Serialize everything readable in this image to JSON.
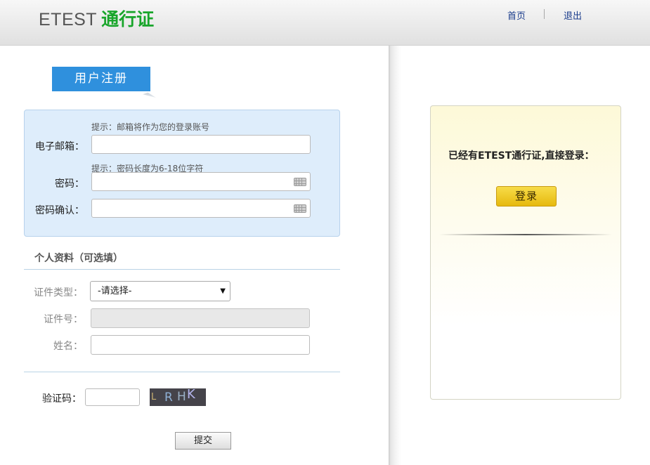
{
  "header": {
    "logo_en": "ETEST",
    "logo_cn": "通行证",
    "nav_home": "首页",
    "nav_logout": "退出"
  },
  "register": {
    "title": "用户注册",
    "email_hint": "提示：邮箱将作为您的登录账号",
    "email_label": "电子邮箱：",
    "password_hint": "提示：密码长度为6-18位字符",
    "password_label": "密码：",
    "confirm_label": "密码确认："
  },
  "profile": {
    "section_title": "个人资料（可选填）",
    "id_type_label": "证件类型：",
    "id_type_selected": "-请选择-",
    "id_number_label": "证件号：",
    "name_label": "姓名："
  },
  "captcha": {
    "label": "验证码：",
    "chars": [
      "L",
      "R",
      "H",
      "K"
    ]
  },
  "submit_label": "提交",
  "login": {
    "prompt": "已经有ETEST通行证,直接登录：",
    "button_label": "登录"
  },
  "colors": {
    "brand_green": "#18a52a",
    "tab_blue": "#2f90dd",
    "panel_blue": "#deedfb",
    "login_yellow": "#f2cb26"
  },
  "icons": {
    "keyboard": "keyboard-icon",
    "dropdown": "chevron-down-icon"
  }
}
